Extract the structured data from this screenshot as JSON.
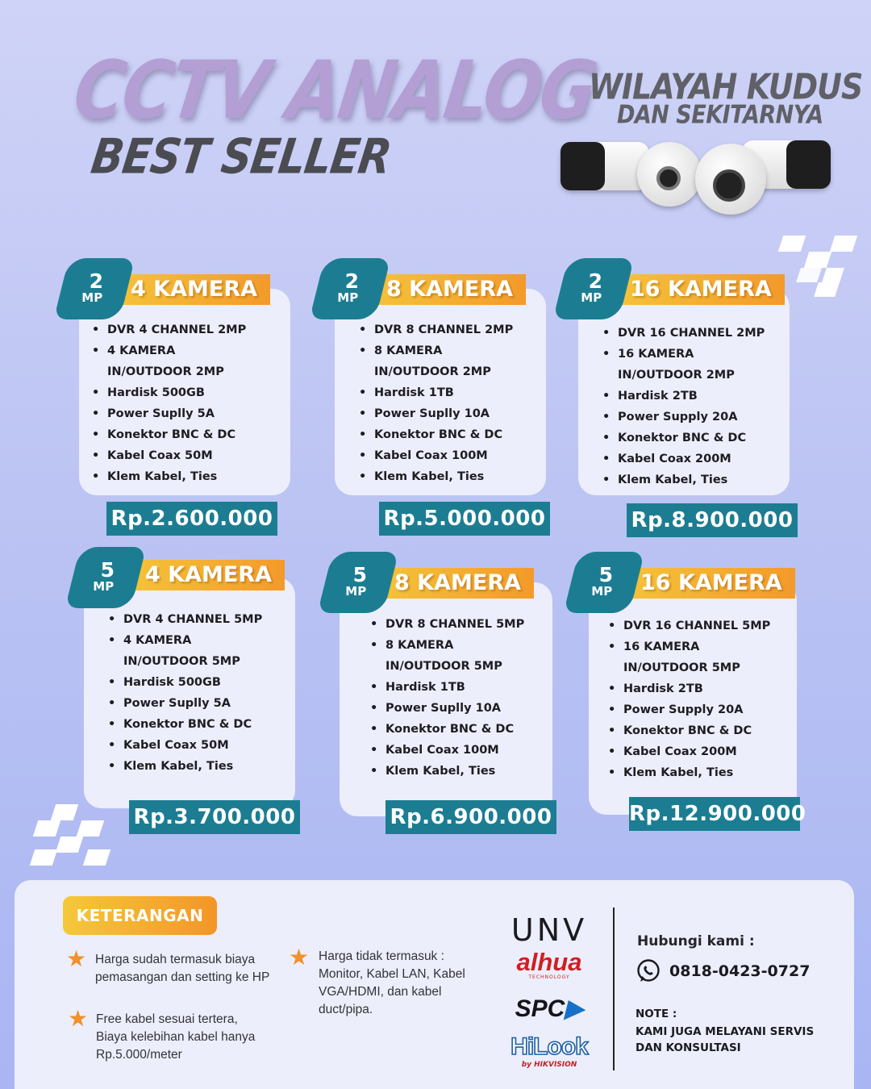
{
  "header": {
    "title": "CCTV ANALOG",
    "subtitle": "BEST SELLER",
    "region_line1": "WILAYAH KUDUS",
    "region_line2": "DAN SEKITARNYA"
  },
  "packages": [
    {
      "mp": "2",
      "unit": "MP",
      "title": "4 KAMERA",
      "items": [
        "DVR 4 CHANNEL 2MP",
        "4 KAMERA",
        "IN/OUTDOOR 2MP",
        "Hardisk 500GB",
        "Power Suplly 5A",
        "Konektor BNC & DC",
        "Kabel Coax 50M",
        "Klem Kabel, Ties"
      ],
      "price": "Rp.2.600.000"
    },
    {
      "mp": "2",
      "unit": "MP",
      "title": "8 KAMERA",
      "items": [
        "DVR 8 CHANNEL 2MP",
        "8 KAMERA",
        "IN/OUTDOOR 2MP",
        "Hardisk 1TB",
        "Power Suplly 10A",
        "Konektor BNC & DC",
        "Kabel Coax 100M",
        "Klem Kabel, Ties"
      ],
      "price": "Rp.5.000.000"
    },
    {
      "mp": "2",
      "unit": "MP",
      "title": "16 KAMERA",
      "items": [
        "DVR 16 CHANNEL 2MP",
        "16 KAMERA",
        "IN/OUTDOOR 2MP",
        "Hardisk 2TB",
        "Power Supply 20A",
        "Konektor BNC & DC",
        "Kabel Coax 200M",
        "Klem Kabel, Ties"
      ],
      "price": "Rp.8.900.000"
    },
    {
      "mp": "5",
      "unit": "MP",
      "title": "4 KAMERA",
      "items": [
        "DVR 4 CHANNEL 5MP",
        "4 KAMERA",
        "IN/OUTDOOR 5MP",
        "Hardisk 500GB",
        "Power Suplly 5A",
        "Konektor BNC & DC",
        "Kabel Coax 50M",
        "Klem Kabel, Ties"
      ],
      "price": "Rp.3.700.000"
    },
    {
      "mp": "5",
      "unit": "MP",
      "title": "8 KAMERA",
      "items": [
        "DVR 8 CHANNEL 5MP",
        "8 KAMERA",
        "IN/OUTDOOR 5MP",
        "Hardisk 1TB",
        "Power Suplly 10A",
        "Konektor BNC & DC",
        "Kabel Coax 100M",
        "Klem Kabel, Ties"
      ],
      "price": "Rp.6.900.000"
    },
    {
      "mp": "5",
      "unit": "MP",
      "title": "16 KAMERA",
      "items": [
        "DVR 16 CHANNEL 5MP",
        "16 KAMERA",
        "IN/OUTDOOR 5MP",
        "Hardisk 2TB",
        "Power Supply 20A",
        "Konektor BNC & DC",
        "Kabel Coax 200M",
        "Klem Kabel, Ties"
      ],
      "price": "Rp.12.900.000"
    }
  ],
  "footer": {
    "label": "KETERANGAN",
    "notes": [
      [
        "Harga sudah termasuk biaya",
        "pemasangan dan setting ke HP"
      ],
      [
        "Harga tidak termasuk :",
        "Monitor, Kabel LAN, Kabel",
        "VGA/HDMI, dan kabel",
        "duct/pipa."
      ],
      [
        "Free kabel sesuai tertera,",
        "Biaya kelebihan kabel hanya",
        "Rp.5.000/meter"
      ]
    ],
    "brands": [
      "UNV",
      "alhua",
      "TECHNOLOGY",
      "SPC",
      "HiLook",
      "by HIKVISION"
    ],
    "contact_title": "Hubungi kami :",
    "phone": "0818-0423-0727",
    "note_title": "NOTE :",
    "note_lines": [
      "KAMI JUGA MELAYANI SERVIS",
      "DAN KONSULTASI"
    ]
  },
  "colors": {
    "accent_teal": "#1c7d92",
    "accent_orange": "#f39a2a",
    "title_purple": "#b39fd4"
  },
  "icons": [
    "star-icon",
    "whatsapp-icon",
    "cctv-camera-icon"
  ]
}
